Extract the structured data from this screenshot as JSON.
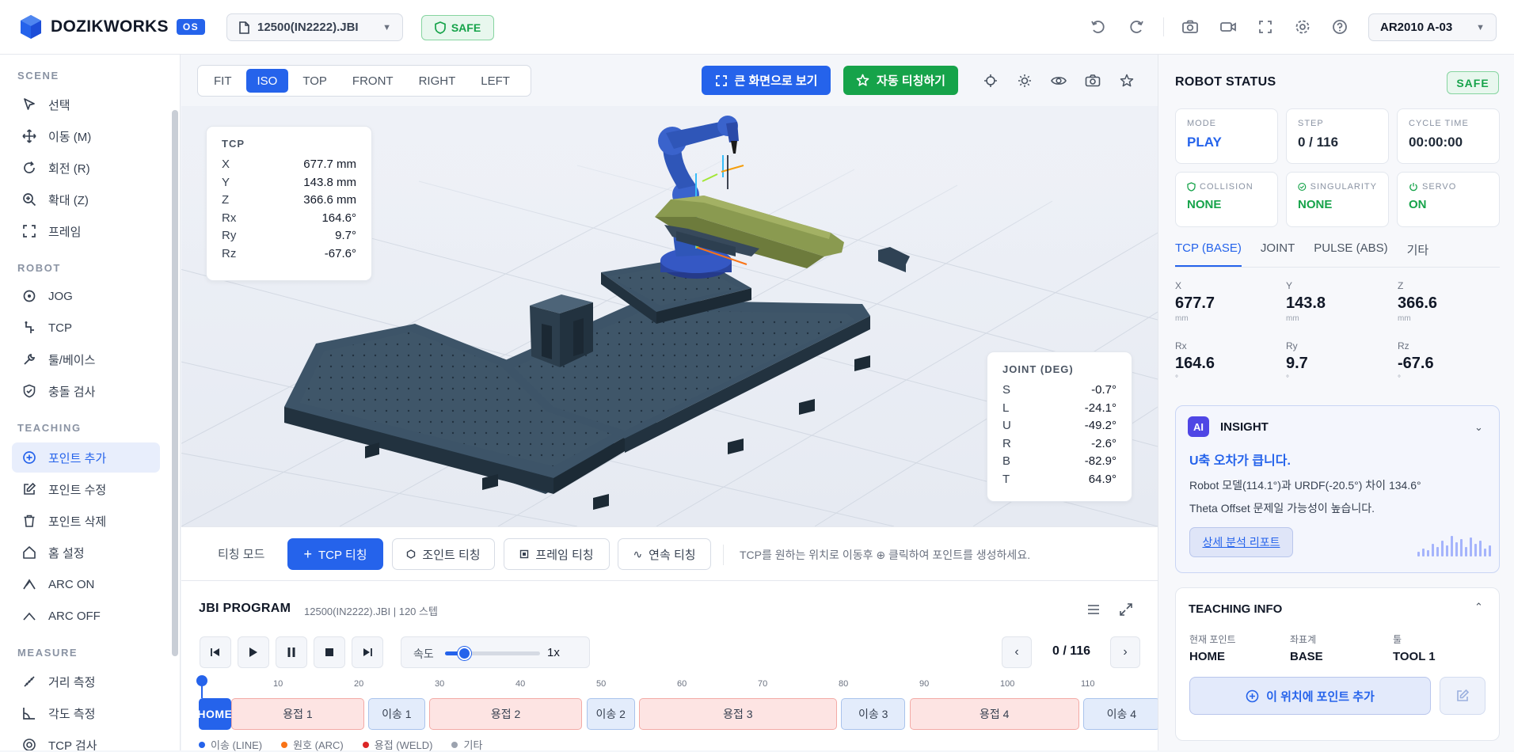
{
  "app": {
    "brand": "DOZIKWORKS",
    "badge": "OS",
    "file": "12500(IN2222).JBI",
    "safe": "SAFE",
    "robot": "AR2010 A-03"
  },
  "sidebar": {
    "sections": {
      "scene": "SCENE",
      "robot": "ROBOT",
      "teaching": "TEACHING",
      "measure": "MEASURE"
    },
    "scene": [
      "선택",
      "이동 (M)",
      "회전 (R)",
      "확대 (Z)",
      "프레임"
    ],
    "robot": [
      "JOG",
      "TCP",
      "툴/베이스",
      "충돌 검사"
    ],
    "teaching": [
      "포인트 추가",
      "포인트 수정",
      "포인트 삭제",
      "홈 설정",
      "ARC ON",
      "ARC OFF"
    ],
    "measure": [
      "거리 측정",
      "각도 측정",
      "TCP 검사"
    ]
  },
  "viewbar": {
    "views": [
      "FIT",
      "ISO",
      "TOP",
      "FRONT",
      "RIGHT",
      "LEFT"
    ],
    "active_view": "ISO",
    "big_view": "큰 화면으로 보기",
    "auto_teach": "자동 티칭하기"
  },
  "tcp": {
    "title": "TCP",
    "rows": [
      {
        "k": "X",
        "v": "677.7 mm"
      },
      {
        "k": "Y",
        "v": "143.8 mm"
      },
      {
        "k": "Z",
        "v": "366.6 mm"
      },
      {
        "k": "Rx",
        "v": "164.6°"
      },
      {
        "k": "Ry",
        "v": "9.7°"
      },
      {
        "k": "Rz",
        "v": "-67.6°"
      }
    ]
  },
  "joint": {
    "title": "JOINT (DEG)",
    "rows": [
      {
        "k": "S",
        "v": "-0.7°"
      },
      {
        "k": "L",
        "v": "-24.1°"
      },
      {
        "k": "U",
        "v": "-49.2°"
      },
      {
        "k": "R",
        "v": "-2.6°"
      },
      {
        "k": "B",
        "v": "-82.9°"
      },
      {
        "k": "T",
        "v": "64.9°"
      }
    ]
  },
  "teach": {
    "mode_label": "티칭 모드",
    "tcp": "TCP 티칭",
    "joint": "조인트 티칭",
    "frame": "프레임 티칭",
    "continuous": "연속 티칭",
    "hint": "TCP를 원하는 위치로 이동후 ⊕ 클릭하여 포인트를 생성하세요."
  },
  "program": {
    "title": "JBI PROGRAM",
    "sub": "12500(IN2222).JBI | 120 스텝",
    "speed_label": "속도",
    "speed_value": "1x",
    "speed_fraction": 0.2,
    "page": "0 / 116",
    "ticks": [
      "10",
      "20",
      "30",
      "40",
      "50",
      "60",
      "70",
      "80",
      "90",
      "100",
      "110"
    ],
    "segments": [
      {
        "label": "HOME",
        "type": "home",
        "start": 0,
        "end": 4
      },
      {
        "label": "용접 1",
        "type": "weld",
        "start": 4,
        "end": 20.5
      },
      {
        "label": "이송 1",
        "type": "move",
        "start": 21,
        "end": 28
      },
      {
        "label": "용접 2",
        "type": "weld",
        "start": 28.5,
        "end": 47.5
      },
      {
        "label": "이송 2",
        "type": "move",
        "start": 48,
        "end": 54
      },
      {
        "label": "용접 3",
        "type": "weld",
        "start": 54.5,
        "end": 79
      },
      {
        "label": "이송 3",
        "type": "move",
        "start": 79.5,
        "end": 87.5
      },
      {
        "label": "용접 4",
        "type": "weld",
        "start": 88,
        "end": 109
      },
      {
        "label": "이송 4",
        "type": "move",
        "start": 109.5,
        "end": 119
      }
    ],
    "legend": [
      {
        "label": "이송 (LINE)",
        "color": "#2563eb"
      },
      {
        "label": "원호 (ARC)",
        "color": "#f97316"
      },
      {
        "label": "용접 (WELD)",
        "color": "#dc2626"
      },
      {
        "label": "기타",
        "color": "#9ca3af"
      }
    ]
  },
  "status": {
    "title": "ROBOT STATUS",
    "safe": "SAFE",
    "mode_k": "MODE",
    "mode_v": "PLAY",
    "step_k": "STEP",
    "step_v": "0 / 116",
    "cycle_k": "CYCLE TIME",
    "cycle_v": "00:00:00",
    "collision_k": "COLLISION",
    "collision_v": "NONE",
    "singularity_k": "SINGULARITY",
    "singularity_v": "NONE",
    "servo_k": "SERVO",
    "servo_v": "ON",
    "tabs": [
      "TCP (BASE)",
      "JOINT",
      "PULSE (ABS)",
      "기타"
    ],
    "coords": [
      {
        "k": "X",
        "v": "677.7",
        "u": "mm"
      },
      {
        "k": "Y",
        "v": "143.8",
        "u": "mm"
      },
      {
        "k": "Z",
        "v": "366.6",
        "u": "mm"
      },
      {
        "k": "Rx",
        "v": "164.6",
        "u": "°"
      },
      {
        "k": "Ry",
        "v": "9.7",
        "u": "°"
      },
      {
        "k": "Rz",
        "v": "-67.6",
        "u": "°"
      }
    ]
  },
  "insight": {
    "badge": "AI",
    "title": "INSIGHT",
    "headline": "U축 오차가 큽니다.",
    "line1": "Robot 모델(114.1°)과 URDF(-20.5°) 차이 134.6°",
    "line2": "Theta Offset 문제일 가능성이 높습니다.",
    "button": "상세 분석 리포트"
  },
  "teaching_info": {
    "title": "TEACHING INFO",
    "point_k": "현재 포인트",
    "point_v": "HOME",
    "frame_k": "좌표계",
    "frame_v": "BASE",
    "tool_k": "툴",
    "tool_v": "TOOL 1",
    "add": "이 위치에 포인트 추가"
  },
  "colors": {
    "accent": "#2563eb",
    "success": "#16a34a",
    "robot_blue": "#2f56b8",
    "table": "#3d5468",
    "part": "#7b8a45"
  }
}
